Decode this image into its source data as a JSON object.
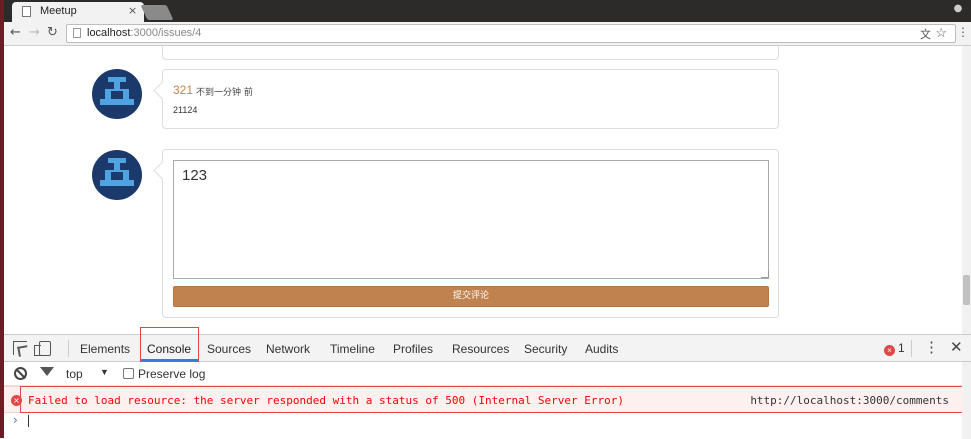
{
  "browser": {
    "tab_title": "Meetup",
    "tab_close": "×",
    "url_host": "localhost",
    "url_path": ":3000/issues/4",
    "back": "←",
    "forward": "→",
    "reload": "↻"
  },
  "comment": {
    "user": "321",
    "time": "不到一分钟 前",
    "body": "21124"
  },
  "form": {
    "textarea_value": "123",
    "submit_label": "提交评论"
  },
  "devtools": {
    "tabs": [
      "Elements",
      "Console",
      "Sources",
      "Network",
      "Timeline",
      "Profiles",
      "Resources",
      "Security",
      "Audits"
    ],
    "active_tab": "Console",
    "error_count": "1",
    "context": "top",
    "preserve_log": "Preserve log",
    "error_message": "Failed to load resource: the server responded with a status of 500 (Internal Server Error)",
    "error_source": "http://localhost:3000/comments",
    "prompt": "›"
  },
  "colors": {
    "accent_brown": "#c0834f",
    "error_red": "#e04848",
    "link_blue": "#3879d9"
  }
}
